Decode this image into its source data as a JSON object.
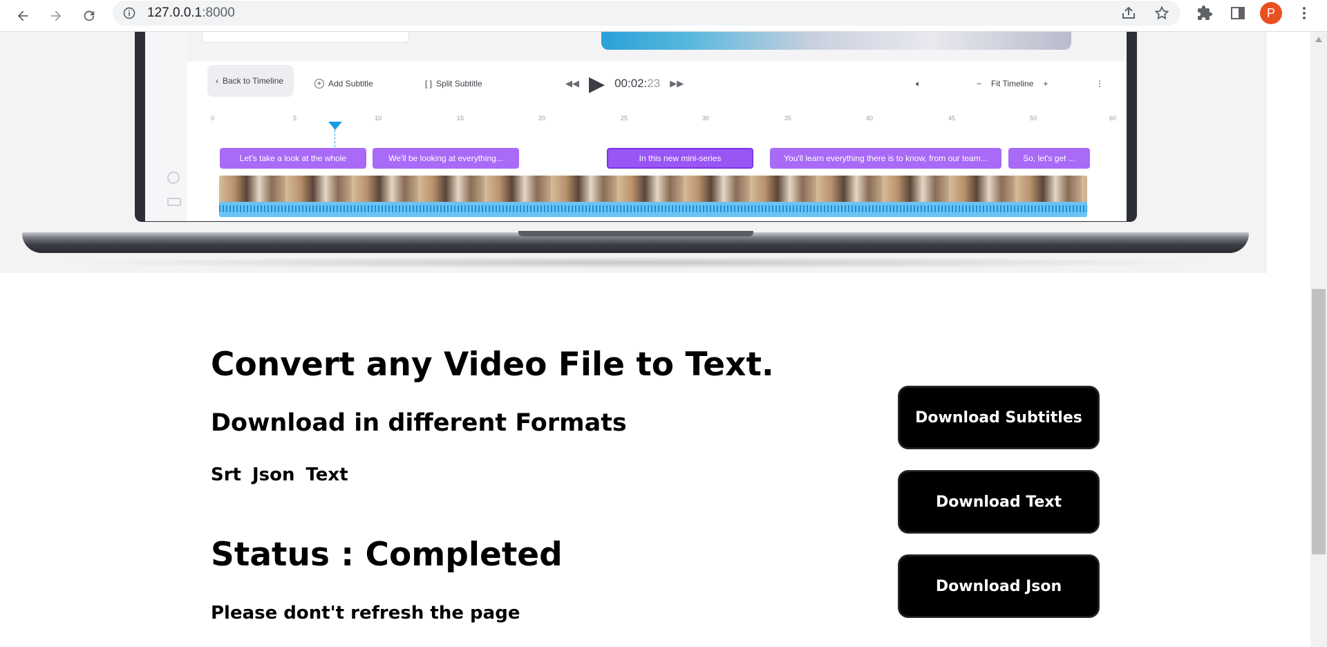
{
  "browser": {
    "url_host": "127.0.0.1",
    "url_port": ":8000",
    "profile_initial": "P"
  },
  "hero": {
    "toolbar": {
      "back_label": "Back to Timeline",
      "add_subtitle_label": "Add Subtitle",
      "split_subtitle_label": "Split Subtitle",
      "timecode_main": "00:02:",
      "timecode_frames": "23",
      "fit_timeline_label": "Fit Timeline"
    },
    "ruler_ticks": [
      "0",
      "5",
      "10",
      "15",
      "20",
      "25",
      "30",
      "35",
      "40",
      "45",
      "50",
      "60"
    ],
    "subtitles": [
      "Let's take a look at the whole",
      "We'll be looking at everything...",
      "In this new mini-series",
      "You'll learn everything there is to know, from our team...",
      "So, let's get ..."
    ],
    "colors": {
      "subtitle_chip": "#a86af7",
      "playhead": "#1a9be6",
      "waveform": "#6cc3f3"
    }
  },
  "main": {
    "title": "Convert any Video File to Text.",
    "subtitle": "Download in different Formats",
    "formats": [
      "Srt",
      "Json",
      "Text"
    ],
    "status": "Status : Completed",
    "warning": "Please dont't refresh the page"
  },
  "buttons": {
    "download_subtitles": "Download Subtitles",
    "download_text": "Download Text",
    "download_json": "Download Json"
  },
  "icons": {
    "back": "arrow-left-icon",
    "forward": "arrow-right-icon",
    "reload": "reload-icon",
    "site_info": "info-icon",
    "share": "share-icon",
    "bookmark": "star-icon",
    "extensions": "puzzle-icon",
    "side_panel": "side-panel-icon",
    "menu": "kebab-menu-icon"
  }
}
